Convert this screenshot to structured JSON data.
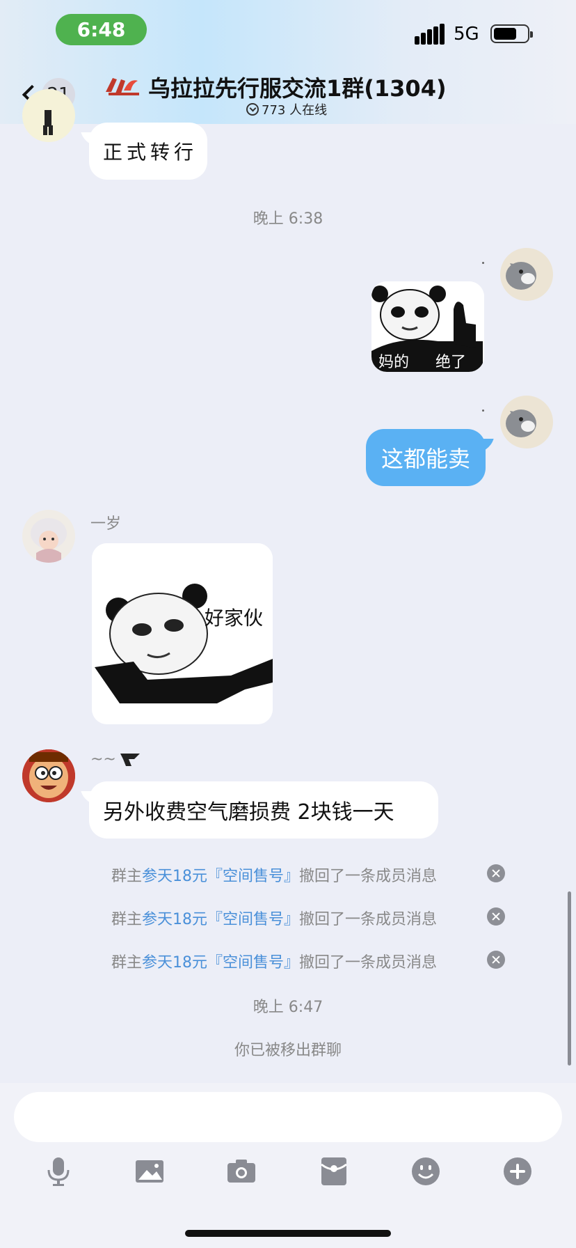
{
  "status_bar": {
    "time": "6:48",
    "network": "5G"
  },
  "header": {
    "unread_count": "21",
    "group_name": "乌拉拉先行服交流1群(1304)",
    "online_text": "773 人在线"
  },
  "messages": {
    "msg1_text": "正式转行",
    "time1": "晚上 6:38",
    "sticker1_caption_a": "妈的",
    "sticker1_caption_b": "绝了",
    "msg2_text": "这都能卖",
    "sender_yisui": "一岁",
    "sticker2_caption": "好家伙",
    "sender_tilde": "~~",
    "msg3_text": "另外收费空气磨损费 2块钱一天"
  },
  "notices": [
    {
      "prefix": "群主",
      "actor": "参天18元『空间售号』",
      "suffix": "撤回了一条成员消息"
    },
    {
      "prefix": "群主",
      "actor": "参天18元『空间售号』",
      "suffix": "撤回了一条成员消息"
    },
    {
      "prefix": "群主",
      "actor": "参天18元『空间售号』",
      "suffix": "撤回了一条成员消息"
    }
  ],
  "time2": "晚上 6:47",
  "removed_text": "你已被移出群聊",
  "toolbar_icons": [
    "microphone-icon",
    "image-icon",
    "camera-icon",
    "red-packet-icon",
    "emoji-icon",
    "plus-icon"
  ],
  "colors": {
    "accent": "#5ab1f3",
    "status_green": "#4fb24f",
    "link": "#4a90d9"
  }
}
